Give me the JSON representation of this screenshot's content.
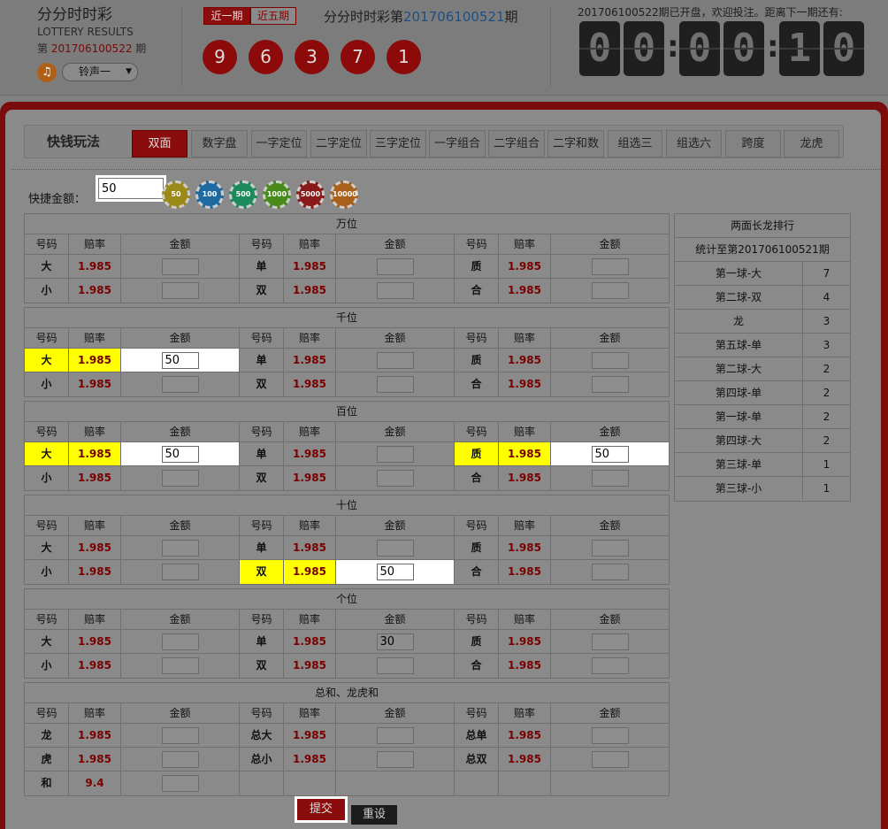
{
  "header": {
    "title": "分分时时彩",
    "subtitle": "LOTTERY RESULTS",
    "period_prefix": "第",
    "period": "201706100522",
    "period_suffix": "期",
    "sound_select": "铃声一",
    "tab_recent1": "近一期",
    "tab_recent5": "近五期",
    "draw_title": "分分时时彩第",
    "draw_period": "201706100521",
    "draw_suffix": "期",
    "balls": [
      "9",
      "6",
      "3",
      "7",
      "1"
    ],
    "countdown_label": "201706100522期已开盘，欢迎投注。距离下一期还有:",
    "countdown_digits": [
      "0",
      "0",
      "0",
      "0",
      "1",
      "0"
    ]
  },
  "games": {
    "label": "快钱玩法",
    "tabs": [
      "双面",
      "数字盘",
      "一字定位",
      "二字定位",
      "三字定位",
      "一字组合",
      "二字组合",
      "二字和数",
      "组选三",
      "组选六",
      "跨度",
      "龙虎"
    ]
  },
  "quick": {
    "label": "快捷金额：",
    "value": "50",
    "chips": [
      "50",
      "100",
      "500",
      "1000",
      "5000",
      "10000"
    ]
  },
  "columns": {
    "number": "号码",
    "odds": "赔率",
    "amount": "金额"
  },
  "sections": [
    {
      "title": "万位",
      "rows": [
        [
          {
            "n": "大",
            "o": "1.985",
            "a": ""
          },
          {
            "n": "单",
            "o": "1.985",
            "a": ""
          },
          {
            "n": "质",
            "o": "1.985",
            "a": ""
          }
        ],
        [
          {
            "n": "小",
            "o": "1.985",
            "a": ""
          },
          {
            "n": "双",
            "o": "1.985",
            "a": ""
          },
          {
            "n": "合",
            "o": "1.985",
            "a": ""
          }
        ]
      ]
    },
    {
      "title": "千位",
      "rows": [
        [
          {
            "n": "大",
            "o": "1.985",
            "a": "50",
            "hl": true
          },
          {
            "n": "单",
            "o": "1.985",
            "a": ""
          },
          {
            "n": "质",
            "o": "1.985",
            "a": ""
          }
        ],
        [
          {
            "n": "小",
            "o": "1.985",
            "a": ""
          },
          {
            "n": "双",
            "o": "1.985",
            "a": ""
          },
          {
            "n": "合",
            "o": "1.985",
            "a": ""
          }
        ]
      ]
    },
    {
      "title": "百位",
      "rows": [
        [
          {
            "n": "大",
            "o": "1.985",
            "a": "50",
            "hl": true
          },
          {
            "n": "单",
            "o": "1.985",
            "a": ""
          },
          {
            "n": "质",
            "o": "1.985",
            "a": "50",
            "hl": true
          }
        ],
        [
          {
            "n": "小",
            "o": "1.985",
            "a": ""
          },
          {
            "n": "双",
            "o": "1.985",
            "a": ""
          },
          {
            "n": "合",
            "o": "1.985",
            "a": ""
          }
        ]
      ]
    },
    {
      "title": "十位",
      "rows": [
        [
          {
            "n": "大",
            "o": "1.985",
            "a": ""
          },
          {
            "n": "单",
            "o": "1.985",
            "a": ""
          },
          {
            "n": "质",
            "o": "1.985",
            "a": ""
          }
        ],
        [
          {
            "n": "小",
            "o": "1.985",
            "a": ""
          },
          {
            "n": "双",
            "o": "1.985",
            "a": "50",
            "hl": true
          },
          {
            "n": "合",
            "o": "1.985",
            "a": ""
          }
        ]
      ]
    },
    {
      "title": "个位",
      "rows": [
        [
          {
            "n": "大",
            "o": "1.985",
            "a": ""
          },
          {
            "n": "单",
            "o": "1.985",
            "a": "30"
          },
          {
            "n": "质",
            "o": "1.985",
            "a": ""
          }
        ],
        [
          {
            "n": "小",
            "o": "1.985",
            "a": ""
          },
          {
            "n": "双",
            "o": "1.985",
            "a": ""
          },
          {
            "n": "合",
            "o": "1.985",
            "a": ""
          }
        ]
      ]
    },
    {
      "title": "总和、龙虎和",
      "rows": [
        [
          {
            "n": "龙",
            "o": "1.985",
            "a": ""
          },
          {
            "n": "总大",
            "o": "1.985",
            "a": ""
          },
          {
            "n": "总单",
            "o": "1.985",
            "a": ""
          }
        ],
        [
          {
            "n": "虎",
            "o": "1.985",
            "a": ""
          },
          {
            "n": "总小",
            "o": "1.985",
            "a": ""
          },
          {
            "n": "总双",
            "o": "1.985",
            "a": ""
          }
        ],
        [
          {
            "n": "和",
            "o": "9.4",
            "a": ""
          },
          null,
          null
        ]
      ]
    }
  ],
  "ranking": {
    "title": "两面长龙排行",
    "subtitle": "统计至第201706100521期",
    "rows": [
      {
        "name": "第一球-大",
        "count": "7"
      },
      {
        "name": "第二球-双",
        "count": "4"
      },
      {
        "name": "龙",
        "count": "3"
      },
      {
        "name": "第五球-单",
        "count": "3"
      },
      {
        "name": "第二球-大",
        "count": "2"
      },
      {
        "name": "第四球-单",
        "count": "2"
      },
      {
        "name": "第一球-单",
        "count": "2"
      },
      {
        "name": "第四球-大",
        "count": "2"
      },
      {
        "name": "第三球-单",
        "count": "1"
      },
      {
        "name": "第三球-小",
        "count": "1"
      }
    ]
  },
  "buttons": {
    "submit": "提交",
    "reset": "重设"
  },
  "colors": {
    "accent": "#8a0c0c",
    "highlight": "#ffff00",
    "odds": "#7a0000"
  }
}
